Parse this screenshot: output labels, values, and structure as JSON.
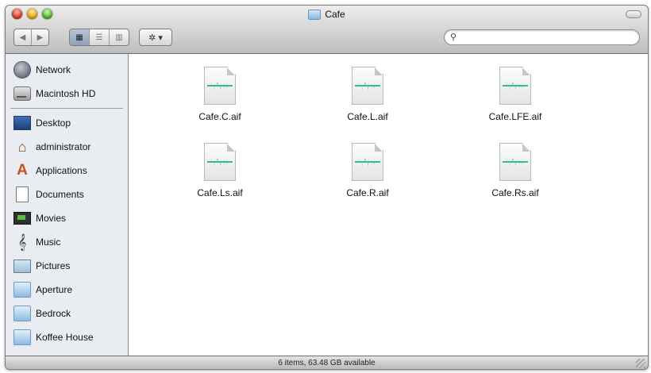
{
  "window": {
    "title": "Cafe"
  },
  "toolbar": {
    "back_icon": "back-arrow-icon",
    "forward_icon": "forward-arrow-icon",
    "view_modes": [
      "icon-view-icon",
      "list-view-icon",
      "column-view-icon"
    ],
    "action_icon": "gear-icon",
    "search_placeholder": ""
  },
  "sidebar": {
    "devices": [
      {
        "label": "Network",
        "icon": "globe-icon"
      },
      {
        "label": "Macintosh HD",
        "icon": "hard-drive-icon"
      }
    ],
    "places": [
      {
        "label": "Desktop",
        "icon": "desktop-icon"
      },
      {
        "label": "administrator",
        "icon": "home-icon"
      },
      {
        "label": "Applications",
        "icon": "applications-icon"
      },
      {
        "label": "Documents",
        "icon": "document-icon"
      },
      {
        "label": "Movies",
        "icon": "movie-icon"
      },
      {
        "label": "Music",
        "icon": "music-icon"
      },
      {
        "label": "Pictures",
        "icon": "pictures-icon"
      },
      {
        "label": "Aperture",
        "icon": "folder-icon"
      },
      {
        "label": "Bedrock",
        "icon": "folder-icon"
      },
      {
        "label": "Koffee House",
        "icon": "folder-icon"
      }
    ]
  },
  "files": [
    {
      "name": "Cafe.C.aif"
    },
    {
      "name": "Cafe.L.aif"
    },
    {
      "name": "Cafe.LFE.aif"
    },
    {
      "name": "Cafe.Ls.aif"
    },
    {
      "name": "Cafe.R.aif"
    },
    {
      "name": "Cafe.Rs.aif"
    }
  ],
  "status": {
    "text": "6 items, 63.48 GB available"
  },
  "colors": {
    "accent": "#8ea0b8",
    "waveform": "#2dbf94"
  }
}
